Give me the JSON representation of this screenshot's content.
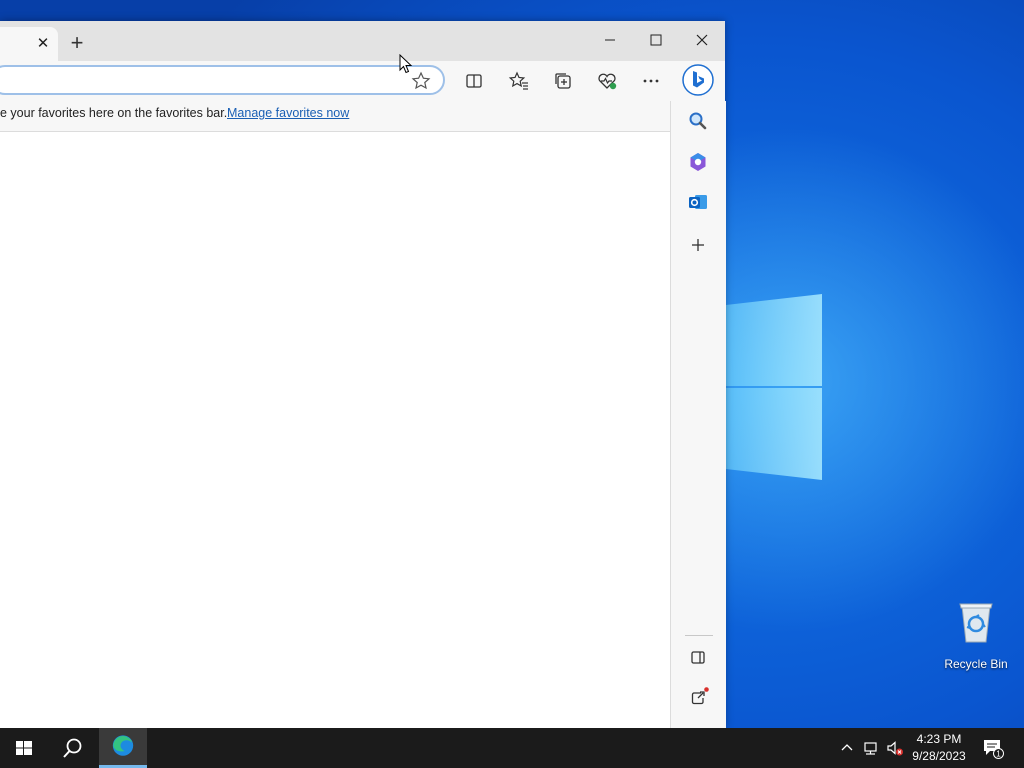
{
  "favorites_bar": {
    "message": "e your favorites here on the favorites bar.",
    "link": "Manage favorites now"
  },
  "desktop": {
    "icons": [
      {
        "label": "Recycle Bin",
        "icon": "recycle-bin-icon"
      }
    ]
  },
  "taskbar": {
    "time": "4:23 PM",
    "date": "9/28/2023",
    "notification_count": "1"
  },
  "colors": {
    "accent": "#1a5fb4",
    "desktop_blue": "#0a5fd6",
    "taskbar": "#1b1b1b",
    "edge_active_underline": "#76b9ed"
  }
}
